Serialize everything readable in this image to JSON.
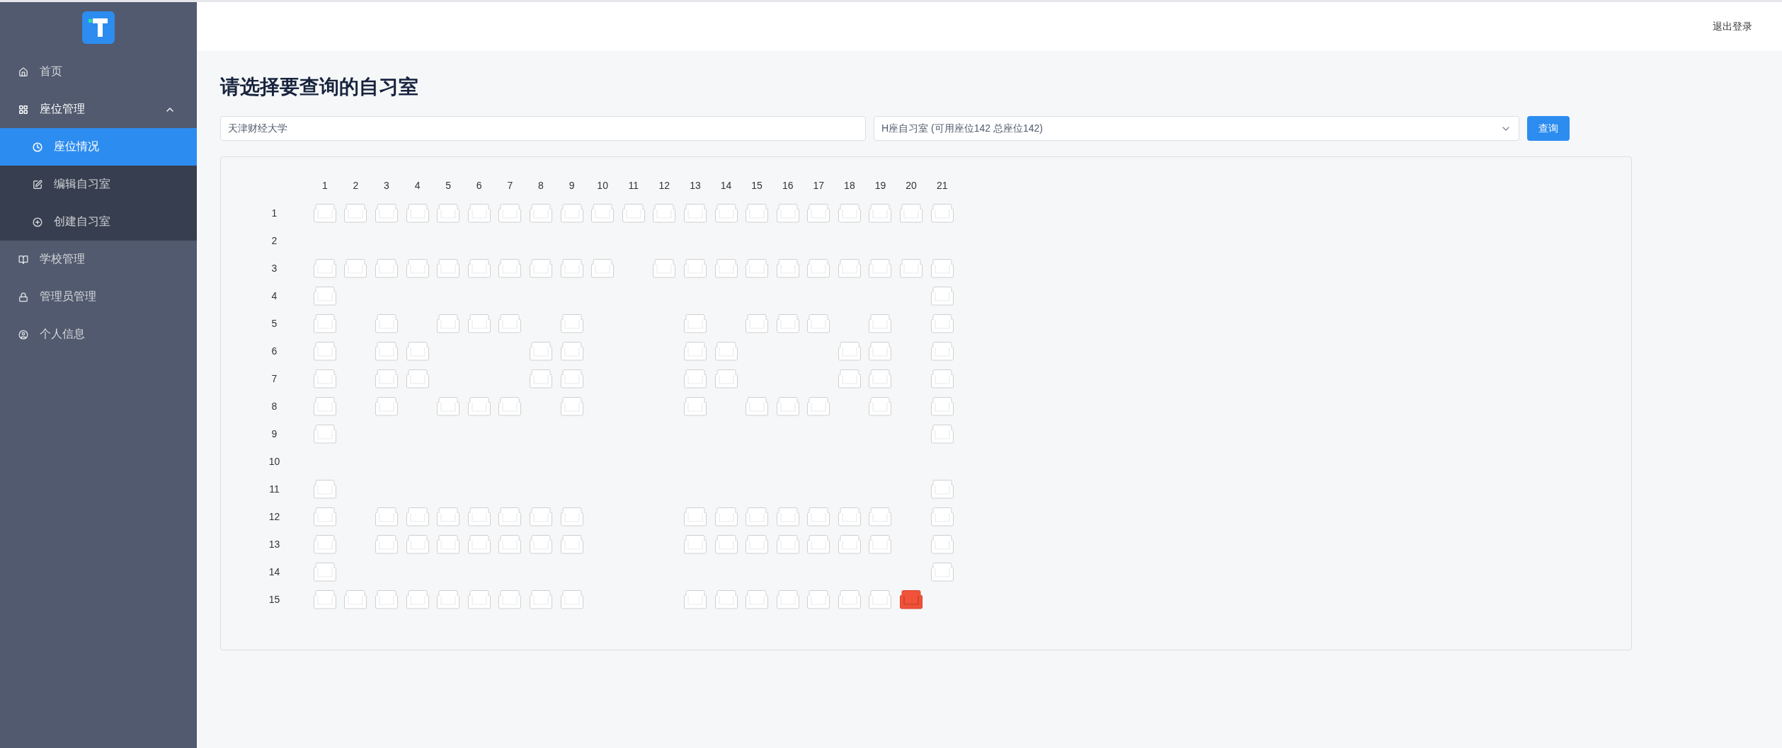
{
  "header": {
    "logout": "退出登录"
  },
  "sidebar": {
    "items": [
      {
        "label": "首页",
        "selected": false
      },
      {
        "label": "座位管理",
        "expanded": true,
        "selected": false,
        "children": [
          {
            "label": "座位情况",
            "selected": true
          },
          {
            "label": "编辑自习室",
            "selected": false
          },
          {
            "label": "创建自习室",
            "selected": false
          }
        ]
      },
      {
        "label": "学校管理",
        "selected": false
      },
      {
        "label": "管理员管理",
        "selected": false
      },
      {
        "label": "个人信息",
        "selected": false
      }
    ]
  },
  "page_title": "请选择要查询的自习室",
  "school_field": {
    "value": "天津财经大学"
  },
  "room_select": {
    "value": "H座自习室 (可用座位142 总座位142)"
  },
  "query_button": "查询",
  "seat_map": {
    "columns": [
      "1",
      "2",
      "3",
      "4",
      "5",
      "6",
      "7",
      "8",
      "9",
      "10",
      "11",
      "12",
      "13",
      "14",
      "15",
      "16",
      "17",
      "18",
      "19",
      "20",
      "21"
    ],
    "rows": [
      {
        "label": "1",
        "seats": [
          {
            "kind": "free"
          },
          {
            "kind": "free"
          },
          {
            "kind": "free"
          },
          {
            "kind": "free"
          },
          {
            "kind": "free"
          },
          {
            "kind": "free"
          },
          {
            "kind": "free"
          },
          {
            "kind": "free"
          },
          {
            "kind": "free"
          },
          {
            "kind": "free"
          },
          {
            "kind": "free"
          },
          {
            "kind": "free"
          },
          {
            "kind": "free"
          },
          {
            "kind": "free"
          },
          {
            "kind": "free"
          },
          {
            "kind": "free"
          },
          {
            "kind": "free"
          },
          {
            "kind": "free"
          },
          {
            "kind": "free"
          },
          {
            "kind": "free"
          },
          {
            "kind": "free"
          }
        ]
      },
      {
        "label": "2",
        "seats": [
          {
            "kind": "aisle"
          },
          {
            "kind": "aisle"
          },
          {
            "kind": "aisle"
          },
          {
            "kind": "aisle"
          },
          {
            "kind": "aisle"
          },
          {
            "kind": "aisle"
          },
          {
            "kind": "aisle"
          },
          {
            "kind": "aisle"
          },
          {
            "kind": "aisle"
          },
          {
            "kind": "aisle"
          },
          {
            "kind": "aisle"
          },
          {
            "kind": "aisle"
          },
          {
            "kind": "aisle"
          },
          {
            "kind": "aisle"
          },
          {
            "kind": "aisle"
          },
          {
            "kind": "aisle"
          },
          {
            "kind": "aisle"
          },
          {
            "kind": "aisle"
          },
          {
            "kind": "aisle"
          },
          {
            "kind": "aisle"
          },
          {
            "kind": "aisle"
          }
        ]
      },
      {
        "label": "3",
        "seats": [
          {
            "kind": "free"
          },
          {
            "kind": "free"
          },
          {
            "kind": "free"
          },
          {
            "kind": "free"
          },
          {
            "kind": "free"
          },
          {
            "kind": "free"
          },
          {
            "kind": "free"
          },
          {
            "kind": "free"
          },
          {
            "kind": "free"
          },
          {
            "kind": "free"
          },
          {
            "kind": "aisle"
          },
          {
            "kind": "free"
          },
          {
            "kind": "free"
          },
          {
            "kind": "free"
          },
          {
            "kind": "free"
          },
          {
            "kind": "free"
          },
          {
            "kind": "free"
          },
          {
            "kind": "free"
          },
          {
            "kind": "free"
          },
          {
            "kind": "free"
          },
          {
            "kind": "free"
          }
        ]
      },
      {
        "label": "4",
        "seats": [
          {
            "kind": "free"
          },
          {
            "kind": "aisle"
          },
          {
            "kind": "aisle"
          },
          {
            "kind": "aisle"
          },
          {
            "kind": "aisle"
          },
          {
            "kind": "aisle"
          },
          {
            "kind": "aisle"
          },
          {
            "kind": "aisle"
          },
          {
            "kind": "aisle"
          },
          {
            "kind": "aisle"
          },
          {
            "kind": "aisle"
          },
          {
            "kind": "aisle"
          },
          {
            "kind": "aisle"
          },
          {
            "kind": "aisle"
          },
          {
            "kind": "aisle"
          },
          {
            "kind": "aisle"
          },
          {
            "kind": "aisle"
          },
          {
            "kind": "aisle"
          },
          {
            "kind": "aisle"
          },
          {
            "kind": "aisle"
          },
          {
            "kind": "free"
          }
        ]
      },
      {
        "label": "5",
        "seats": [
          {
            "kind": "free"
          },
          {
            "kind": "aisle"
          },
          {
            "kind": "free"
          },
          {
            "kind": "aisle"
          },
          {
            "kind": "free"
          },
          {
            "kind": "free"
          },
          {
            "kind": "free"
          },
          {
            "kind": "aisle"
          },
          {
            "kind": "free"
          },
          {
            "kind": "aisle"
          },
          {
            "kind": "aisle"
          },
          {
            "kind": "aisle"
          },
          {
            "kind": "free"
          },
          {
            "kind": "aisle"
          },
          {
            "kind": "free"
          },
          {
            "kind": "free"
          },
          {
            "kind": "free"
          },
          {
            "kind": "aisle"
          },
          {
            "kind": "free"
          },
          {
            "kind": "aisle"
          },
          {
            "kind": "free"
          }
        ]
      },
      {
        "label": "6",
        "seats": [
          {
            "kind": "free"
          },
          {
            "kind": "aisle"
          },
          {
            "kind": "free"
          },
          {
            "kind": "free"
          },
          {
            "kind": "aisle"
          },
          {
            "kind": "aisle"
          },
          {
            "kind": "aisle"
          },
          {
            "kind": "free"
          },
          {
            "kind": "free"
          },
          {
            "kind": "aisle"
          },
          {
            "kind": "aisle"
          },
          {
            "kind": "aisle"
          },
          {
            "kind": "free"
          },
          {
            "kind": "free"
          },
          {
            "kind": "aisle"
          },
          {
            "kind": "aisle"
          },
          {
            "kind": "aisle"
          },
          {
            "kind": "free"
          },
          {
            "kind": "free"
          },
          {
            "kind": "aisle"
          },
          {
            "kind": "free"
          }
        ]
      },
      {
        "label": "7",
        "seats": [
          {
            "kind": "free"
          },
          {
            "kind": "aisle"
          },
          {
            "kind": "free"
          },
          {
            "kind": "free"
          },
          {
            "kind": "aisle"
          },
          {
            "kind": "aisle"
          },
          {
            "kind": "aisle"
          },
          {
            "kind": "free"
          },
          {
            "kind": "free"
          },
          {
            "kind": "aisle"
          },
          {
            "kind": "aisle"
          },
          {
            "kind": "aisle"
          },
          {
            "kind": "free"
          },
          {
            "kind": "free"
          },
          {
            "kind": "aisle"
          },
          {
            "kind": "aisle"
          },
          {
            "kind": "aisle"
          },
          {
            "kind": "free"
          },
          {
            "kind": "free"
          },
          {
            "kind": "aisle"
          },
          {
            "kind": "free"
          }
        ]
      },
      {
        "label": "8",
        "seats": [
          {
            "kind": "free"
          },
          {
            "kind": "aisle"
          },
          {
            "kind": "free"
          },
          {
            "kind": "aisle"
          },
          {
            "kind": "free"
          },
          {
            "kind": "free"
          },
          {
            "kind": "free"
          },
          {
            "kind": "aisle"
          },
          {
            "kind": "free"
          },
          {
            "kind": "aisle"
          },
          {
            "kind": "aisle"
          },
          {
            "kind": "aisle"
          },
          {
            "kind": "free"
          },
          {
            "kind": "aisle"
          },
          {
            "kind": "free"
          },
          {
            "kind": "free"
          },
          {
            "kind": "free"
          },
          {
            "kind": "aisle"
          },
          {
            "kind": "free"
          },
          {
            "kind": "aisle"
          },
          {
            "kind": "free"
          }
        ]
      },
      {
        "label": "9",
        "seats": [
          {
            "kind": "free"
          },
          {
            "kind": "aisle"
          },
          {
            "kind": "aisle"
          },
          {
            "kind": "aisle"
          },
          {
            "kind": "aisle"
          },
          {
            "kind": "aisle"
          },
          {
            "kind": "aisle"
          },
          {
            "kind": "aisle"
          },
          {
            "kind": "aisle"
          },
          {
            "kind": "aisle"
          },
          {
            "kind": "aisle"
          },
          {
            "kind": "aisle"
          },
          {
            "kind": "aisle"
          },
          {
            "kind": "aisle"
          },
          {
            "kind": "aisle"
          },
          {
            "kind": "aisle"
          },
          {
            "kind": "aisle"
          },
          {
            "kind": "aisle"
          },
          {
            "kind": "aisle"
          },
          {
            "kind": "aisle"
          },
          {
            "kind": "free"
          }
        ]
      },
      {
        "label": "10",
        "seats": [
          {
            "kind": "aisle"
          },
          {
            "kind": "aisle"
          },
          {
            "kind": "aisle"
          },
          {
            "kind": "aisle"
          },
          {
            "kind": "aisle"
          },
          {
            "kind": "aisle"
          },
          {
            "kind": "aisle"
          },
          {
            "kind": "aisle"
          },
          {
            "kind": "aisle"
          },
          {
            "kind": "aisle"
          },
          {
            "kind": "aisle"
          },
          {
            "kind": "aisle"
          },
          {
            "kind": "aisle"
          },
          {
            "kind": "aisle"
          },
          {
            "kind": "aisle"
          },
          {
            "kind": "aisle"
          },
          {
            "kind": "aisle"
          },
          {
            "kind": "aisle"
          },
          {
            "kind": "aisle"
          },
          {
            "kind": "aisle"
          },
          {
            "kind": "aisle"
          }
        ]
      },
      {
        "label": "11",
        "seats": [
          {
            "kind": "free"
          },
          {
            "kind": "aisle"
          },
          {
            "kind": "aisle"
          },
          {
            "kind": "aisle"
          },
          {
            "kind": "aisle"
          },
          {
            "kind": "aisle"
          },
          {
            "kind": "aisle"
          },
          {
            "kind": "aisle"
          },
          {
            "kind": "aisle"
          },
          {
            "kind": "aisle"
          },
          {
            "kind": "aisle"
          },
          {
            "kind": "aisle"
          },
          {
            "kind": "aisle"
          },
          {
            "kind": "aisle"
          },
          {
            "kind": "aisle"
          },
          {
            "kind": "aisle"
          },
          {
            "kind": "aisle"
          },
          {
            "kind": "aisle"
          },
          {
            "kind": "aisle"
          },
          {
            "kind": "aisle"
          },
          {
            "kind": "free"
          }
        ]
      },
      {
        "label": "12",
        "seats": [
          {
            "kind": "free"
          },
          {
            "kind": "aisle"
          },
          {
            "kind": "free"
          },
          {
            "kind": "free"
          },
          {
            "kind": "free"
          },
          {
            "kind": "free"
          },
          {
            "kind": "free"
          },
          {
            "kind": "free"
          },
          {
            "kind": "free"
          },
          {
            "kind": "aisle"
          },
          {
            "kind": "aisle"
          },
          {
            "kind": "aisle"
          },
          {
            "kind": "free"
          },
          {
            "kind": "free"
          },
          {
            "kind": "free"
          },
          {
            "kind": "free"
          },
          {
            "kind": "free"
          },
          {
            "kind": "free"
          },
          {
            "kind": "free"
          },
          {
            "kind": "aisle"
          },
          {
            "kind": "free"
          }
        ]
      },
      {
        "label": "13",
        "seats": [
          {
            "kind": "free"
          },
          {
            "kind": "aisle"
          },
          {
            "kind": "free"
          },
          {
            "kind": "free"
          },
          {
            "kind": "free"
          },
          {
            "kind": "free"
          },
          {
            "kind": "free"
          },
          {
            "kind": "free"
          },
          {
            "kind": "free"
          },
          {
            "kind": "aisle"
          },
          {
            "kind": "aisle"
          },
          {
            "kind": "aisle"
          },
          {
            "kind": "free"
          },
          {
            "kind": "free"
          },
          {
            "kind": "free"
          },
          {
            "kind": "free"
          },
          {
            "kind": "free"
          },
          {
            "kind": "free"
          },
          {
            "kind": "free"
          },
          {
            "kind": "aisle"
          },
          {
            "kind": "free"
          }
        ]
      },
      {
        "label": "14",
        "seats": [
          {
            "kind": "free"
          },
          {
            "kind": "aisle"
          },
          {
            "kind": "aisle"
          },
          {
            "kind": "aisle"
          },
          {
            "kind": "aisle"
          },
          {
            "kind": "aisle"
          },
          {
            "kind": "aisle"
          },
          {
            "kind": "aisle"
          },
          {
            "kind": "aisle"
          },
          {
            "kind": "aisle"
          },
          {
            "kind": "aisle"
          },
          {
            "kind": "aisle"
          },
          {
            "kind": "aisle"
          },
          {
            "kind": "aisle"
          },
          {
            "kind": "aisle"
          },
          {
            "kind": "aisle"
          },
          {
            "kind": "aisle"
          },
          {
            "kind": "aisle"
          },
          {
            "kind": "aisle"
          },
          {
            "kind": "aisle"
          },
          {
            "kind": "free"
          }
        ]
      },
      {
        "label": "15",
        "seats": [
          {
            "kind": "free"
          },
          {
            "kind": "free"
          },
          {
            "kind": "free"
          },
          {
            "kind": "free"
          },
          {
            "kind": "free"
          },
          {
            "kind": "free"
          },
          {
            "kind": "free"
          },
          {
            "kind": "free"
          },
          {
            "kind": "free"
          },
          {
            "kind": "aisle"
          },
          {
            "kind": "aisle"
          },
          {
            "kind": "aisle"
          },
          {
            "kind": "free"
          },
          {
            "kind": "free"
          },
          {
            "kind": "free"
          },
          {
            "kind": "free"
          },
          {
            "kind": "free"
          },
          {
            "kind": "free"
          },
          {
            "kind": "free"
          },
          {
            "kind": "taken"
          },
          {
            "kind": "aisle"
          }
        ]
      }
    ]
  }
}
